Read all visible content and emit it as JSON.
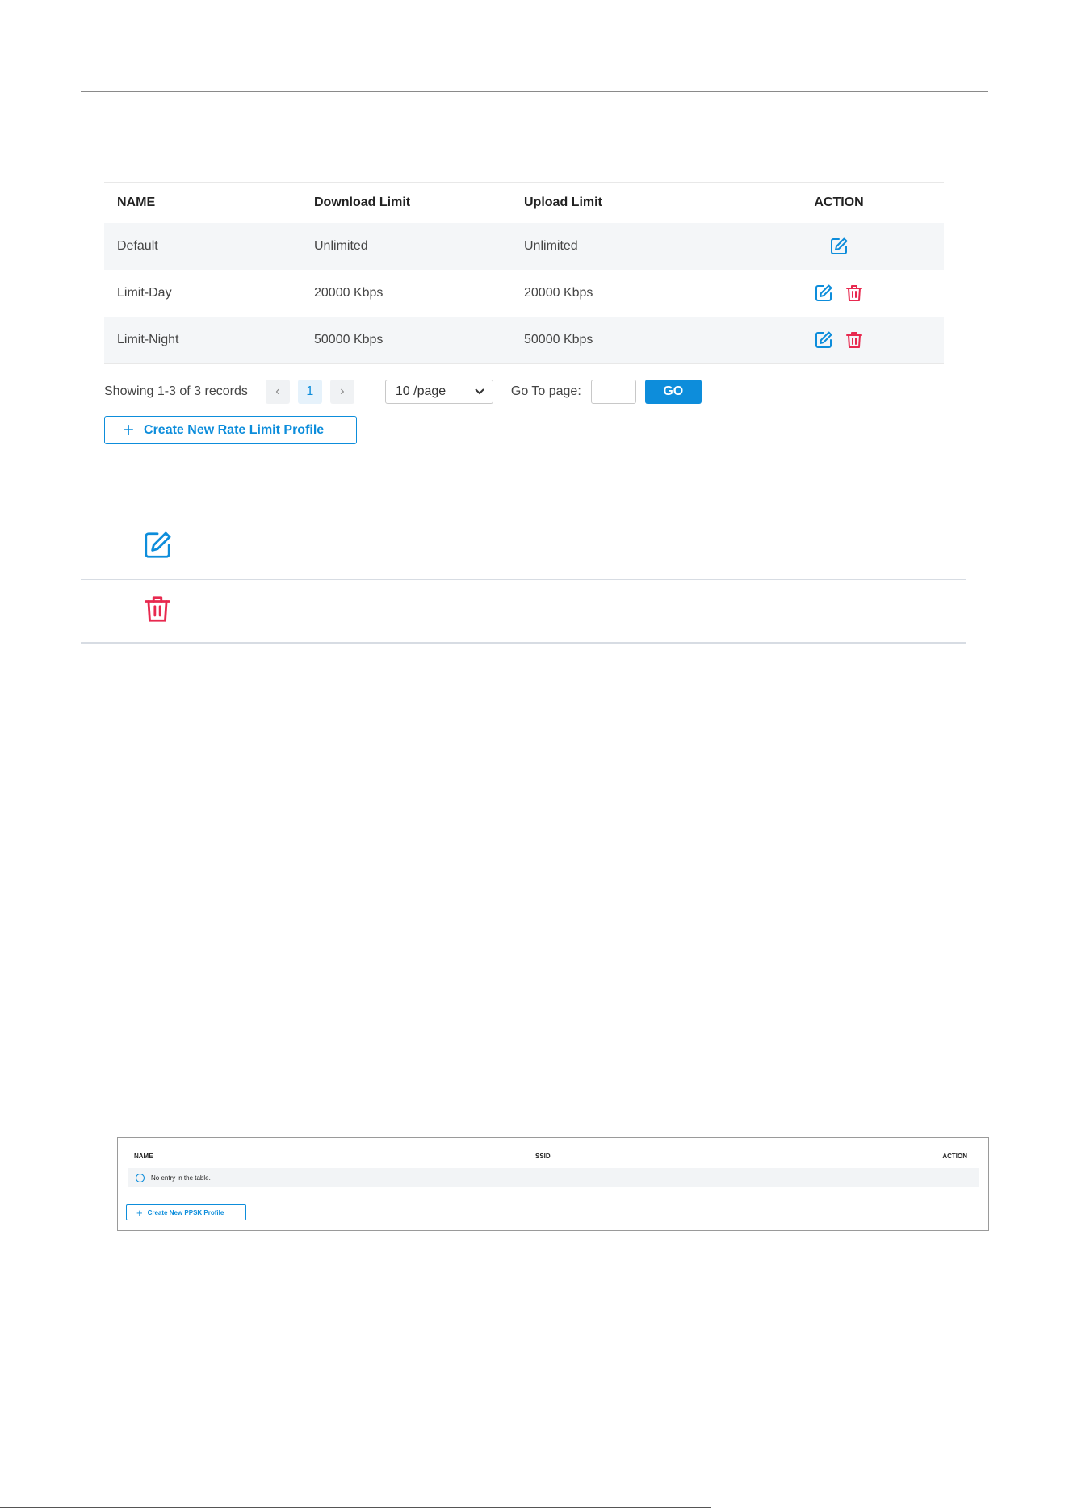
{
  "rate_limit_table": {
    "headers": {
      "name": "NAME",
      "download": "Download Limit",
      "upload": "Upload Limit",
      "action": "ACTION"
    },
    "rows": [
      {
        "name": "Default",
        "download": "Unlimited",
        "upload": "Unlimited",
        "actions": [
          "edit-icon"
        ]
      },
      {
        "name": "Limit-Day",
        "download": "20000 Kbps",
        "upload": "20000 Kbps",
        "actions": [
          "edit-icon",
          "delete-icon"
        ]
      },
      {
        "name": "Limit-Night",
        "download": "50000 Kbps",
        "upload": "50000 Kbps",
        "actions": [
          "edit-icon",
          "delete-icon"
        ]
      }
    ]
  },
  "pagination": {
    "showing": "Showing 1-3 of 3 records",
    "prev": "‹",
    "current_page": "1",
    "next": "›",
    "per_page": "10 /page",
    "goto_label": "Go To page:",
    "goto_value": "",
    "go_label": "GO"
  },
  "create_rate_limit": {
    "plus": "+",
    "label": "Create New Rate Limit Profile"
  },
  "icon_legend": [
    {
      "icon": "edit-icon"
    },
    {
      "icon": "delete-icon"
    }
  ],
  "ppsk_table": {
    "headers": {
      "name": "NAME",
      "ssid": "SSID",
      "action": "ACTION"
    },
    "empty_icon": "i",
    "empty_text": "No entry in the table.",
    "create_plus": "+",
    "create_label": "Create New PPSK Profile"
  },
  "colors": {
    "accent": "#0d8ddb",
    "danger": "#e8294f",
    "row_shade": "#f4f6f8"
  }
}
